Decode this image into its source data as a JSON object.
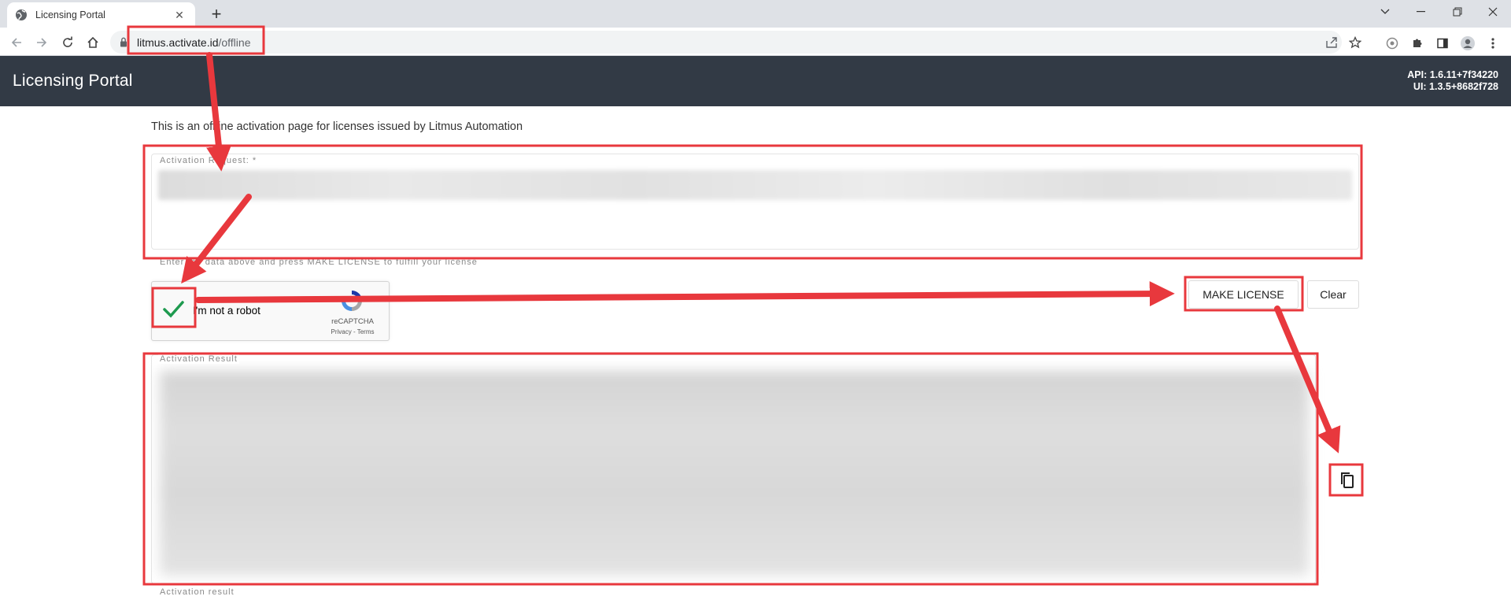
{
  "browser": {
    "tab_title": "Licensing Portal",
    "new_tab": "+",
    "url_host": "litmus.activate.id",
    "url_path": "/offline"
  },
  "header": {
    "title": "Licensing Portal",
    "api_version": "API: 1.6.11+7f34220",
    "ui_version": "UI: 1.3.5+8682f728"
  },
  "page": {
    "intro": "This is an offline activation page for licenses issued by Litmus Automation",
    "request_label": "Activation Request: *",
    "helper_text": "Enter the data above and press MAKE LICENSE to fulfill your license",
    "result_label": "Activation Result",
    "result_bottom_label": "Activation result"
  },
  "recaptcha": {
    "label": "I'm not a robot",
    "brand": "reCAPTCHA",
    "links": "Privacy - Terms"
  },
  "buttons": {
    "make_license": "MAKE LICENSE",
    "clear": "Clear"
  },
  "colors": {
    "header_bg": "#323a45",
    "annotation_red": "#e8383d",
    "check_green": "#1e9a4f"
  }
}
